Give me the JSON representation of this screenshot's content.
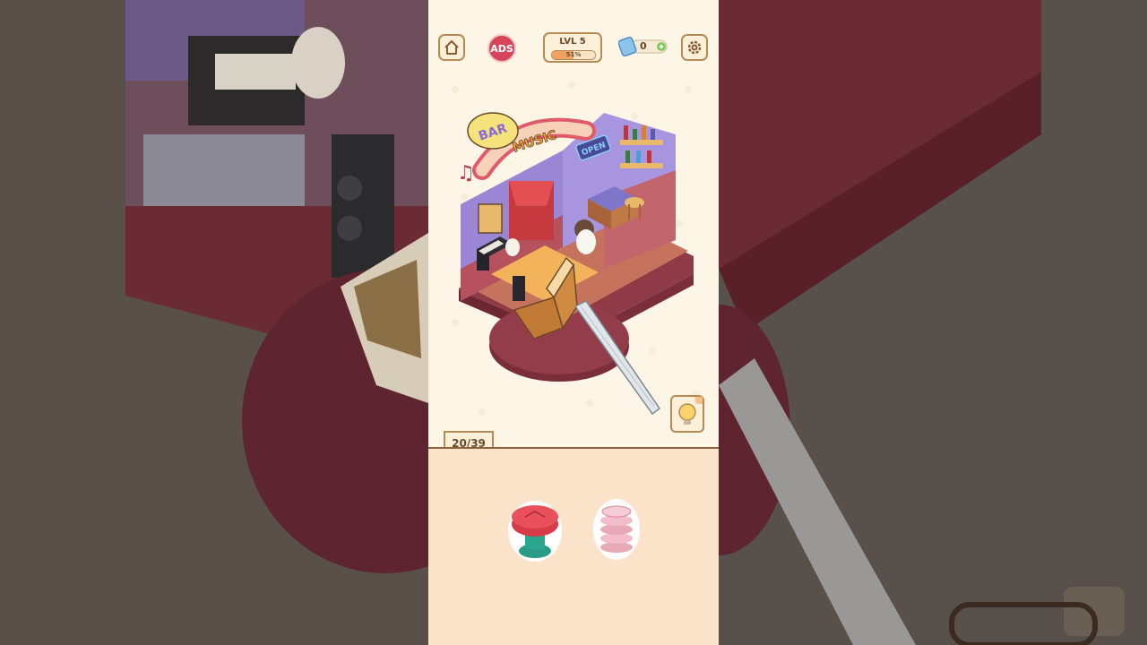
{
  "hud": {
    "home_icon": "home-icon",
    "ads_label": "ADS",
    "level_label": "LVL 5",
    "level_progress_text": "51%",
    "level_progress": 0.51,
    "ticket_count": "0",
    "settings_icon": "gear-icon"
  },
  "scene": {
    "sign_bar": "BAR",
    "sign_music": "MUSIC",
    "sign_open": "OPEN"
  },
  "progress_counter": "20/39",
  "hint_icon": "lightbulb-icon",
  "tray": {
    "items": [
      "red-cushion-stool",
      "pink-cup-stack"
    ]
  },
  "colors": {
    "accent_border": "#b58a55",
    "ads_red": "#d6455a",
    "floor_maroon": "#8e3b47",
    "wall_purple": "#9b86d6",
    "tray_bg": "#fbe3ca"
  }
}
